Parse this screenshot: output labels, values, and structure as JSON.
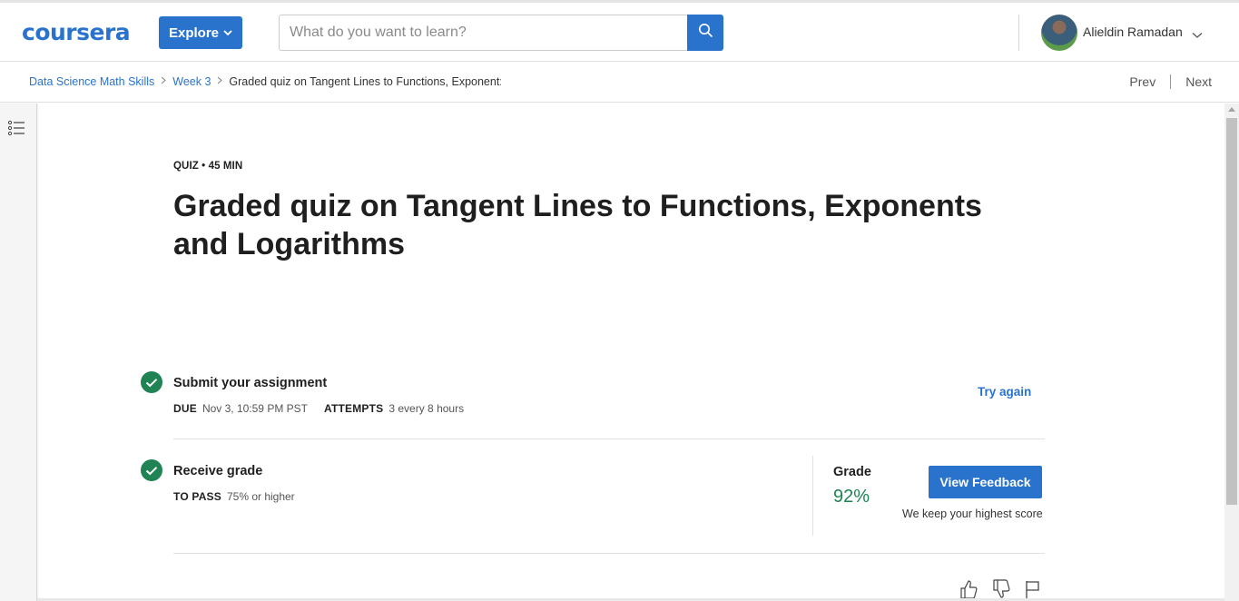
{
  "header": {
    "logo_text": "coursera",
    "explore_label": "Explore",
    "search_placeholder": "What do you want to learn?",
    "user_name": "Alieldin Ramadan",
    "icons": {
      "search": "search-icon",
      "explore_chevron": "chevron-down-icon",
      "user_chevron": "chevron-down-icon",
      "avatar": "user-avatar"
    }
  },
  "breadcrumb": {
    "items": [
      "Data Science Math Skills",
      "Week 3"
    ],
    "current": "Graded quiz on Tangent Lines to Functions, Exponent:",
    "separator_icon": "chevron-right-icon"
  },
  "nav": {
    "prev": "Prev",
    "next": "Next"
  },
  "sidebar": {
    "toggle_icon": "list-menu-icon"
  },
  "quiz": {
    "meta": "QUIZ • 45 MIN",
    "title": "Graded quiz on Tangent Lines to Functions, Exponents and Logarithms"
  },
  "submit": {
    "title": "Submit your assignment",
    "due_label": "DUE",
    "due_value": "Nov 3, 10:59 PM PST",
    "attempts_label": "ATTEMPTS",
    "attempts_value": "3 every 8 hours",
    "try_again": "Try again",
    "status_icon": "check-circle-icon"
  },
  "receive": {
    "title": "Receive grade",
    "pass_label": "TO PASS",
    "pass_value": "75% or higher",
    "grade_label": "Grade",
    "grade_value": "92%",
    "feedback_button": "View Feedback",
    "highest_note": "We keep your highest score",
    "status_icon": "check-circle-icon"
  },
  "footer_actions": [
    "thumbs-up-icon",
    "thumbs-down-icon",
    "flag-icon"
  ],
  "colors": {
    "brand": "#2a73cc",
    "success": "#1f8354",
    "text": "#1f1f1f"
  }
}
